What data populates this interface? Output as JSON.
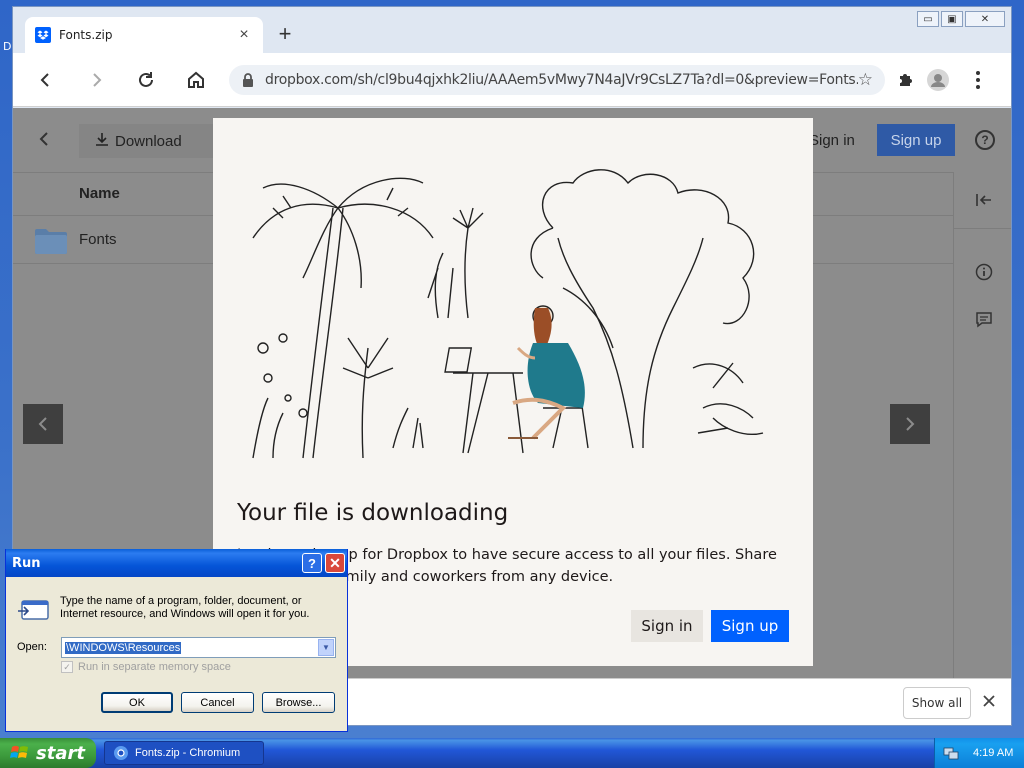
{
  "desktop": {
    "edge_letter": "D"
  },
  "browser": {
    "tab_title": "Fonts.zip",
    "tab_close": "×",
    "new_tab": "+",
    "window_controls": [
      "▭",
      "▣",
      "✕"
    ],
    "url": "dropbox.com/sh/cl9bu4qjxhk2liu/AAAem5vMwy7N4aJVr9CsLZ7Ta?dl=0&preview=Fonts.zip"
  },
  "page": {
    "download_label": "Download",
    "signin_label": "Sign in",
    "signup_label": "Sign up",
    "name_column": "Name",
    "rows": [
      {
        "name": "Fonts"
      }
    ]
  },
  "modal": {
    "title": "Your file is downloading",
    "body": "Log in or sign up for Dropbox to have secure access to all your files. Share with friends, family and coworkers from any device.",
    "signin_label": "Sign in",
    "signup_label": "Sign up"
  },
  "shelf": {
    "show_all": "Show all"
  },
  "run_dialog": {
    "title": "Run",
    "description": "Type the name of a program, folder, document, or Internet resource, and Windows will open it for you.",
    "open_label": "Open:",
    "open_value": "\\WINDOWS\\Resources",
    "checkbox_label": "Run in separate memory space",
    "ok_label": "OK",
    "cancel_label": "Cancel",
    "browse_label": "Browse..."
  },
  "taskbar": {
    "start_label": "start",
    "task_label": "Fonts.zip - Chromium",
    "clock": "4:19 AM"
  },
  "colors": {
    "dropbox_blue": "#0061fe",
    "xp_blue": "#0a5fd8",
    "start_green": "#3c9a3c"
  }
}
